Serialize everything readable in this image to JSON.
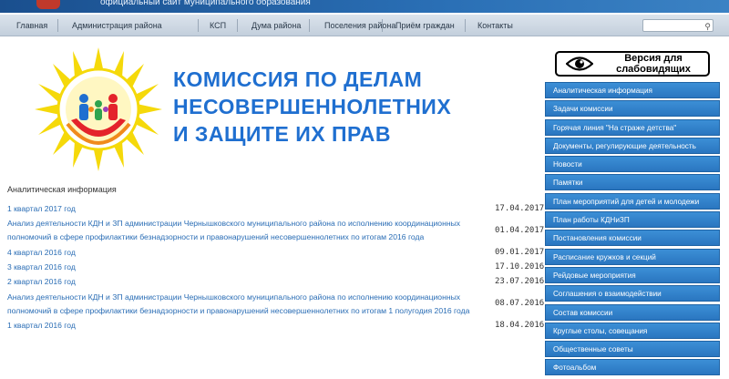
{
  "header": {
    "subtitle": "официальный сайт муниципального образования"
  },
  "nav": {
    "items": [
      "Главная",
      "Администрация района",
      "КСП",
      "Дума района",
      "Поселения района",
      "Приём граждан",
      "Контакты"
    ]
  },
  "search": {
    "placeholder": ""
  },
  "page": {
    "heading_lines": [
      "КОМИССИЯ ПО ДЕЛАМ",
      "НЕСОВЕРШЕННОЛЕТНИХ",
      "И ЗАЩИТЕ ИХ ПРАВ"
    ],
    "section_title": "Аналитическая информация"
  },
  "accessibility": {
    "label_line1": "Версия для",
    "label_line2": "слабовидящих"
  },
  "sidebar": {
    "items": [
      "Аналитическая информация",
      "Задачи комиссии",
      "Горячая линия \"На страже детства\"",
      "Документы, регулирующие деятельность",
      "Новости",
      "Памятки",
      "План мероприятий для детей и молодежи",
      "План работы КДНиЗП",
      "Постановления комиссии",
      "Расписание кружков и секций",
      "Рейдовые мероприятия",
      "Соглашения о взаимодействии",
      "Состав комиссии",
      "Круглые столы, совещания",
      "Общественные советы",
      "Фотоальбом"
    ]
  },
  "documents": [
    {
      "lines": [
        "1 квартал 2017 год"
      ],
      "date": "17.04.2017"
    },
    {
      "lines": [
        "Анализ деятельности КДН и ЗП администрации Чернышковского муниципального района по исполнению координационных",
        "полномочий в сфере профилактики безнадзорности и правонарушений несовершеннолетних по итогам 2016 года"
      ],
      "date": "01.04.2017"
    },
    {
      "lines": [
        "4 квартал 2016 год"
      ],
      "date": "09.01.2017"
    },
    {
      "lines": [
        "3 квартал 2016 год"
      ],
      "date": "17.10.2016"
    },
    {
      "lines": [
        "2 квартал 2016 год"
      ],
      "date": "23.07.2016"
    },
    {
      "lines": [
        "Анализ деятельности КДН и ЗП администрации Чернышковского муниципального района по исполнению координационных",
        "полномочий в сфере профилактики безнадзорности и правонарушений несовершеннолетних по итогам 1 полугодия 2016 года"
      ],
      "date": "08.07.2016"
    },
    {
      "lines": [
        "1 квартал 2016 год"
      ],
      "date": "18.04.2016"
    }
  ],
  "colors": {
    "accent": "#1f6fd0",
    "sidebar_bg": "#2f80c8",
    "link": "#2a6db5"
  }
}
